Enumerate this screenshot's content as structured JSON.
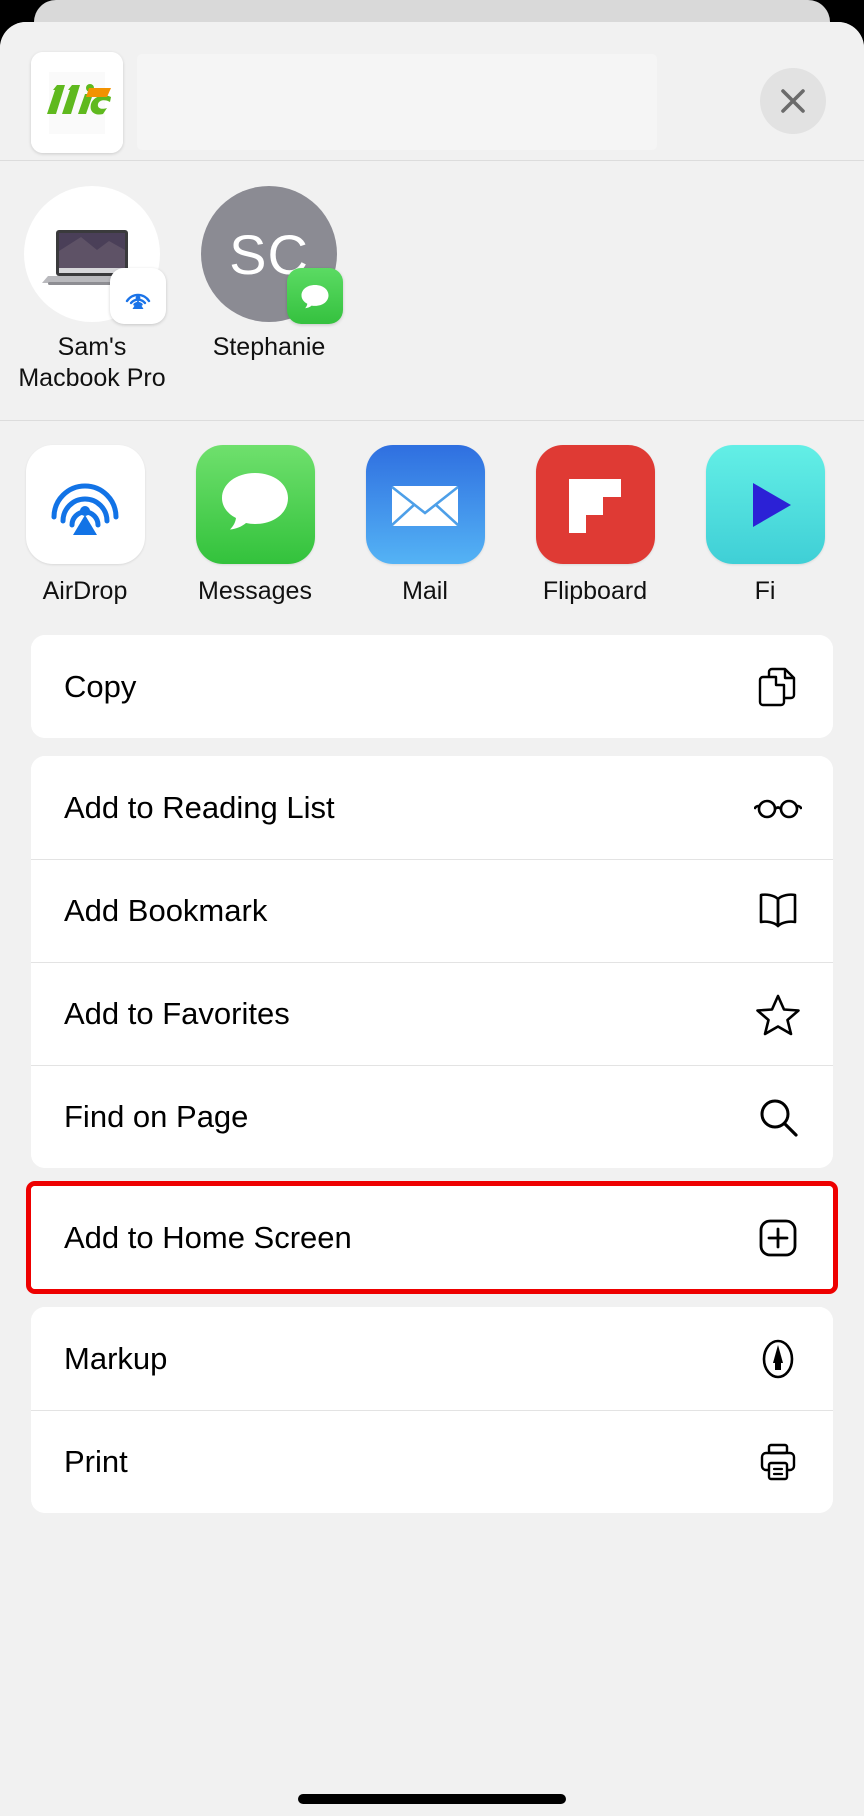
{
  "sheet": {
    "close_label": "Close",
    "preview": {
      "icon": "app-logo-11ic",
      "logo_text": "11iC",
      "logo_green": "#5fb91e",
      "logo_orange": "#f39200"
    }
  },
  "airdrop": {
    "people": [
      {
        "name": "Sam's\nMacbook Pro",
        "line1": "Sam's",
        "line2": "Macbook Pro",
        "avatar_type": "macbook-image",
        "badge": "airdrop-icon",
        "badge_style": "white"
      },
      {
        "name": "Stephanie",
        "line1": "Stephanie",
        "line2": "",
        "avatar_type": "initials",
        "initials": "SC",
        "badge": "messages-icon",
        "badge_style": "green"
      }
    ]
  },
  "apps": [
    {
      "label": "AirDrop",
      "icon": "airdrop-icon",
      "bg": "#ffffff"
    },
    {
      "label": "Messages",
      "icon": "messages-icon",
      "bg": "#5bd75f"
    },
    {
      "label": "Mail",
      "icon": "mail-icon",
      "bg": "#2f74e0"
    },
    {
      "label": "Flipboard",
      "icon": "flipboard-icon",
      "bg": "#df3a34"
    },
    {
      "label": "Fi",
      "icon": "play-icon",
      "bg": "#53e0dd"
    }
  ],
  "action_groups": [
    {
      "highlighted": false,
      "rows": [
        {
          "label": "Copy",
          "icon": "copy-documents-icon"
        }
      ]
    },
    {
      "highlighted": false,
      "rows": [
        {
          "label": "Add to Reading List",
          "icon": "glasses-icon"
        },
        {
          "label": "Add Bookmark",
          "icon": "book-icon"
        },
        {
          "label": "Add to Favorites",
          "icon": "star-icon"
        },
        {
          "label": "Find on Page",
          "icon": "search-icon"
        }
      ]
    },
    {
      "highlighted": true,
      "rows": [
        {
          "label": "Add to Home Screen",
          "icon": "plus-square-icon"
        }
      ]
    },
    {
      "highlighted": false,
      "rows": [
        {
          "label": "Markup",
          "icon": "markup-pen-icon"
        },
        {
          "label": "Print",
          "icon": "printer-icon"
        }
      ]
    }
  ],
  "highlight_color": "#ee0000"
}
